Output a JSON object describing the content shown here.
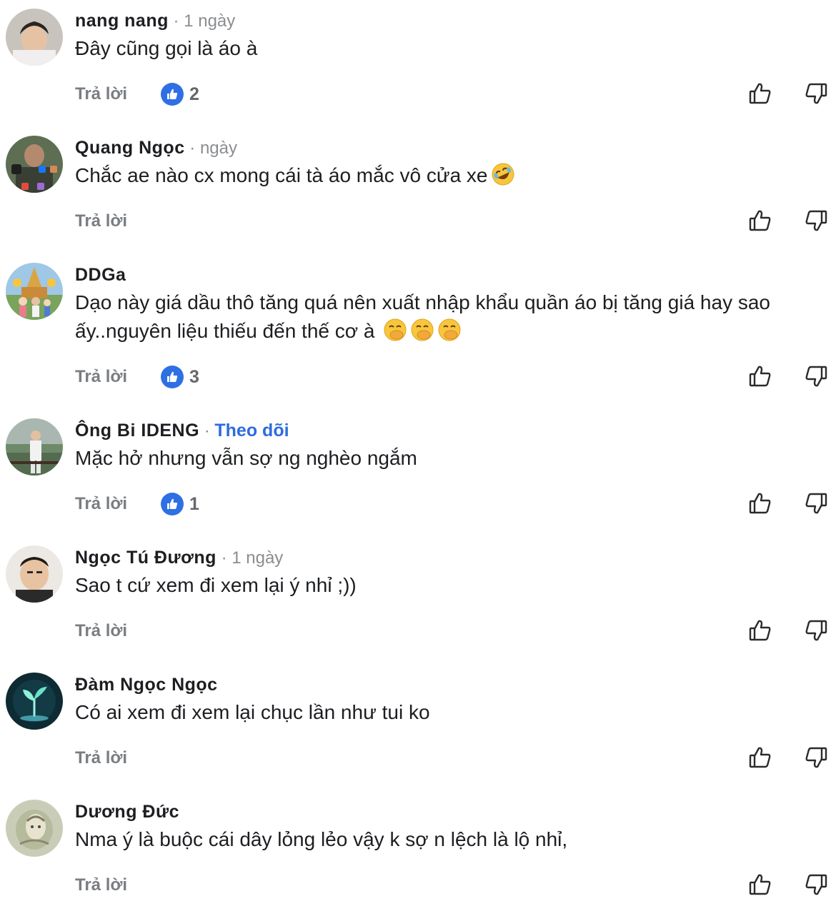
{
  "reply_label": "Trả lời",
  "icons": {
    "like": "thumbs-up-icon",
    "dislike": "thumbs-down-icon",
    "reaction": "like-reaction-icon"
  },
  "colors": {
    "link": "#2d6cdf",
    "reaction_badge": "#2f6fe4",
    "meta": "#8a8d91",
    "reply": "#7a7d82"
  },
  "comments": [
    {
      "author": "nang nang",
      "meta": " · 1 ngày",
      "text": "Đây cũng gọi là áo à",
      "likes": "2"
    },
    {
      "author": "Quang Ngọc",
      "meta": " · ngày",
      "text": "Chắc ae nào cx mong cái tà áo mắc vô cửa xe",
      "emoji": "rolling-on-floor-laughing",
      "likes": ""
    },
    {
      "author": "DDGa",
      "meta": "",
      "text": "Dạo này giá dầu thô tăng quá nên xuất nhập khẩu quần áo bị tăng giá hay sao ấy..nguyên liệu thiếu đến thế cơ à",
      "emoji": "face-with-hand-over-mouth x3",
      "likes": "3"
    },
    {
      "author": "Ông Bi IDENG",
      "meta": " · ",
      "follow": "Theo dõi",
      "text": "Mặc hở nhưng vẫn sợ ng nghèo ngắm",
      "likes": "1"
    },
    {
      "author": "Ngọc Tú Đương",
      "meta": " · 1 ngày",
      "text": "Sao t cứ xem đi xem lại ý nhỉ ;))",
      "likes": ""
    },
    {
      "author": "Đàm Ngọc Ngọc",
      "meta": "",
      "text": "Có ai xem đi xem lại chục lần như tui ko",
      "likes": ""
    },
    {
      "author": "Dương Đức",
      "meta": "",
      "text": "Nma ý là buộc cái dây lỏng lẻo vậy k sợ n lệch là lộ nhỉ,",
      "likes": ""
    }
  ]
}
